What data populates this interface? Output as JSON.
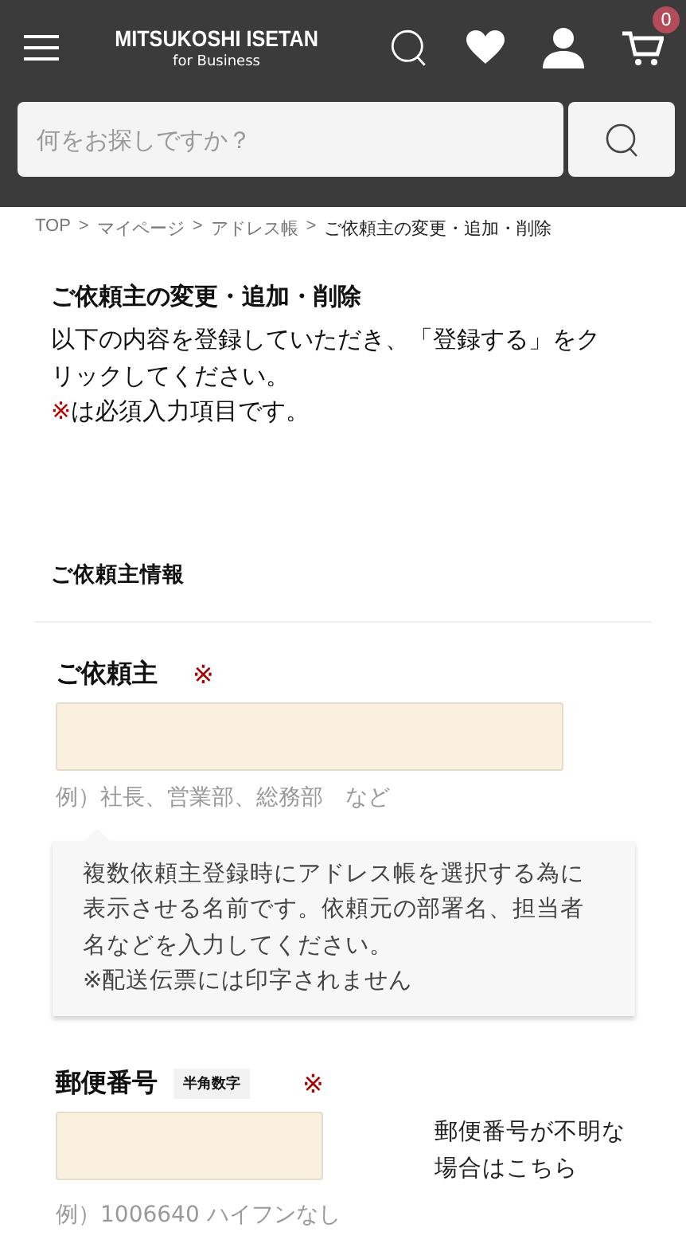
{
  "header": {
    "logo_title": "MITSUKOSHI ISETAN",
    "logo_subtitle": "for Business",
    "cart_count": "0"
  },
  "search": {
    "placeholder": "何をお探しですか？"
  },
  "breadcrumb": [
    {
      "label": "TOP",
      "separator": ">",
      "current": false
    },
    {
      "label": "マイページ",
      "separator": ">",
      "current": false
    },
    {
      "label": "アドレス帳",
      "separator": ">",
      "current": false
    },
    {
      "label": "ご依頼主の変更・追加・削除",
      "current": true
    }
  ],
  "page": {
    "title": "ご依頼主の変更・追加・削除",
    "intro": "以下の内容を登録していただき、「登録する」をクリックしてください。",
    "required_mark": "※",
    "required_note": "は必須入力項目です。"
  },
  "section": {
    "title": "ご依頼主情報"
  },
  "fields": [
    {
      "kind": "wide",
      "label": "ご依頼主",
      "required": true,
      "required_mark": "※",
      "example": "例）社長、営業部、総務部　など",
      "tooltip": {
        "text": "複数依頼主登録時にアドレス帳を選択する為に表示させる名前です。依頼元の部署名、担当者名などを入力してください。",
        "note": "※配送伝票には印字されません"
      }
    },
    {
      "kind": "short",
      "label": "郵便番号",
      "badge": "半角数字",
      "required": true,
      "required_mark": "※",
      "example": "例）1006640 ハイフンなし",
      "side_link": "郵便番号が不明な場合はこちら"
    }
  ]
}
